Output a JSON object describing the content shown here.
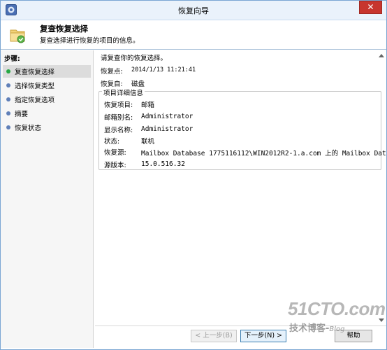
{
  "window": {
    "title": "恢复向导",
    "close_glyph": "✕",
    "app_icon": "wizard-app-icon"
  },
  "header": {
    "title": "复查恢复选择",
    "subtitle": "复查选择进行恢复的项目的信息。",
    "icon": "recovery-wizard-icon"
  },
  "sidebar": {
    "title": "步骤:",
    "items": [
      {
        "label": "复查恢复选择",
        "active": true
      },
      {
        "label": "选择恢复类型",
        "active": false
      },
      {
        "label": "指定恢复选项",
        "active": false
      },
      {
        "label": "摘要",
        "active": false
      },
      {
        "label": "恢复状态",
        "active": false
      }
    ]
  },
  "main": {
    "intro": "请复查你的恢复选择。",
    "recovery_point_label": "恢复点:",
    "recovery_point_value": "2014/1/13 11:21:41",
    "recover_from_label": "恢复自:",
    "recover_from_value": "磁盘",
    "details_group_title": "项目详细信息",
    "details": [
      {
        "label": "恢复项目:",
        "value": "邮箱"
      },
      {
        "label": "邮箱别名:",
        "value": "Administrator"
      },
      {
        "label": "显示名称:",
        "value": "Administrator"
      },
      {
        "label": "状态:",
        "value": "联机"
      },
      {
        "label": "恢复源:",
        "value": "Mailbox Database 1775116112\\WIN2012R2-1.a.com 上的 Mailbox Dat..."
      },
      {
        "label": "源版本:",
        "value": "15.0.516.32"
      }
    ]
  },
  "footer": {
    "back_label": "< 上一步(B)",
    "next_label": "下一步(N) >",
    "help_label": "帮助"
  },
  "watermark": {
    "line1": "51CTO.com",
    "line2": "技术博客",
    "line2_suffix": "Blog"
  }
}
